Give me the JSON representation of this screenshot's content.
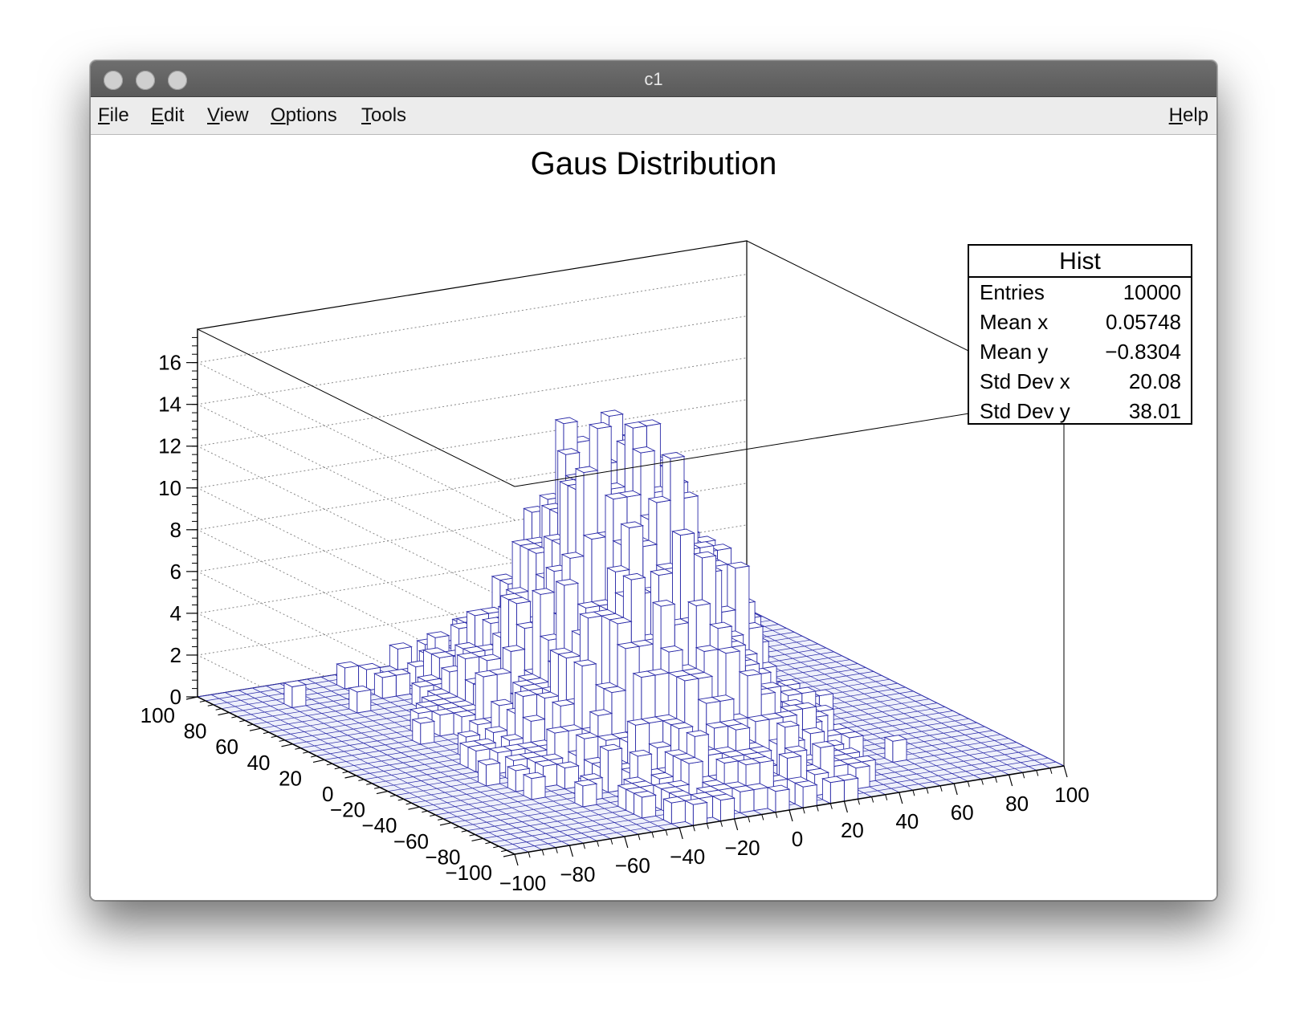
{
  "window": {
    "title": "c1"
  },
  "menu": {
    "file": {
      "first": "F",
      "rest": "ile"
    },
    "edit": {
      "first": "E",
      "rest": "dit"
    },
    "view": {
      "first": "V",
      "rest": "iew"
    },
    "options": {
      "first": "O",
      "rest": "ptions"
    },
    "tools": {
      "first": "T",
      "rest": "ools"
    },
    "help": {
      "first": "H",
      "rest": "elp"
    }
  },
  "stats": {
    "title": "Hist",
    "entries_label": "Entries",
    "entries_value": "10000",
    "meanx_label": "Mean x",
    "meanx_value": "0.05748",
    "meany_label": "Mean y",
    "meany_value": "−0.8304",
    "stdx_label": "Std Dev x",
    "stdx_value": "20.08",
    "stdy_label": "Std Dev y",
    "stdy_value": "38.01"
  },
  "colors": {
    "bars": "#2b2ba8",
    "frame": "#000000",
    "grid": "#888888"
  },
  "chart_data": {
    "type": "lego",
    "title": "Gaus Distribution",
    "x_ticks": [
      "−100",
      "−80",
      "−60",
      "−40",
      "−20",
      "0",
      "20",
      "40",
      "60",
      "80",
      "100"
    ],
    "y_ticks": [
      "100",
      "80",
      "60",
      "40",
      "20",
      "0",
      "−20",
      "−40",
      "−60",
      "−80",
      "−100"
    ],
    "z_ticks": [
      "0",
      "2",
      "4",
      "6",
      "8",
      "10",
      "12",
      "14",
      "16"
    ],
    "xlim": [
      -100,
      100
    ],
    "ylim": [
      -100,
      100
    ],
    "zlim": [
      0,
      17.6
    ],
    "grid": true,
    "peak_bin_content": 15,
    "entries": 10000,
    "mean_x": 0.05748,
    "mean_y": -0.8304,
    "std_dev_x": 20.08,
    "std_dev_y": 38.01
  }
}
